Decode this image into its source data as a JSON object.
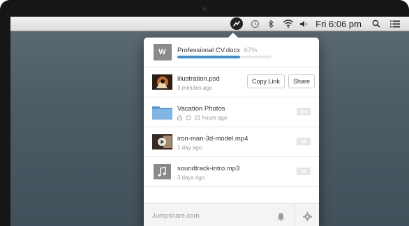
{
  "menubar": {
    "icons": [
      "jumpshare-icon",
      "time-machine-icon",
      "bluetooth-icon",
      "wifi-icon",
      "volume-icon",
      "spotlight-search-icon",
      "notification-list-icon"
    ],
    "clock": "Fri 6:06 pm"
  },
  "upload": {
    "name": "Professional CV.docx",
    "percent_label": "67%",
    "progress": 0.67,
    "thumb_letter": "W"
  },
  "files": [
    {
      "name": "illustration.psd",
      "meta": "3 minutes ago",
      "type": "image"
    },
    {
      "name": "Vacation Photos",
      "meta": "21 hours ago",
      "count": "110",
      "type": "folder"
    },
    {
      "name": "iron-man-3d-model.mp4",
      "meta": "1 day ago",
      "count": "39",
      "type": "video"
    },
    {
      "name": "soundtrack-intro.mp3",
      "meta": "3 days ago",
      "count": "84",
      "type": "audio"
    }
  ],
  "actions": {
    "copy_link": "Copy Link",
    "share": "Share"
  },
  "footer": {
    "brand": "Jumpshare.com"
  },
  "colors": {
    "accent": "#3b8fd6",
    "folder": "#6aa9dc",
    "badge": "#e6e6e6"
  }
}
